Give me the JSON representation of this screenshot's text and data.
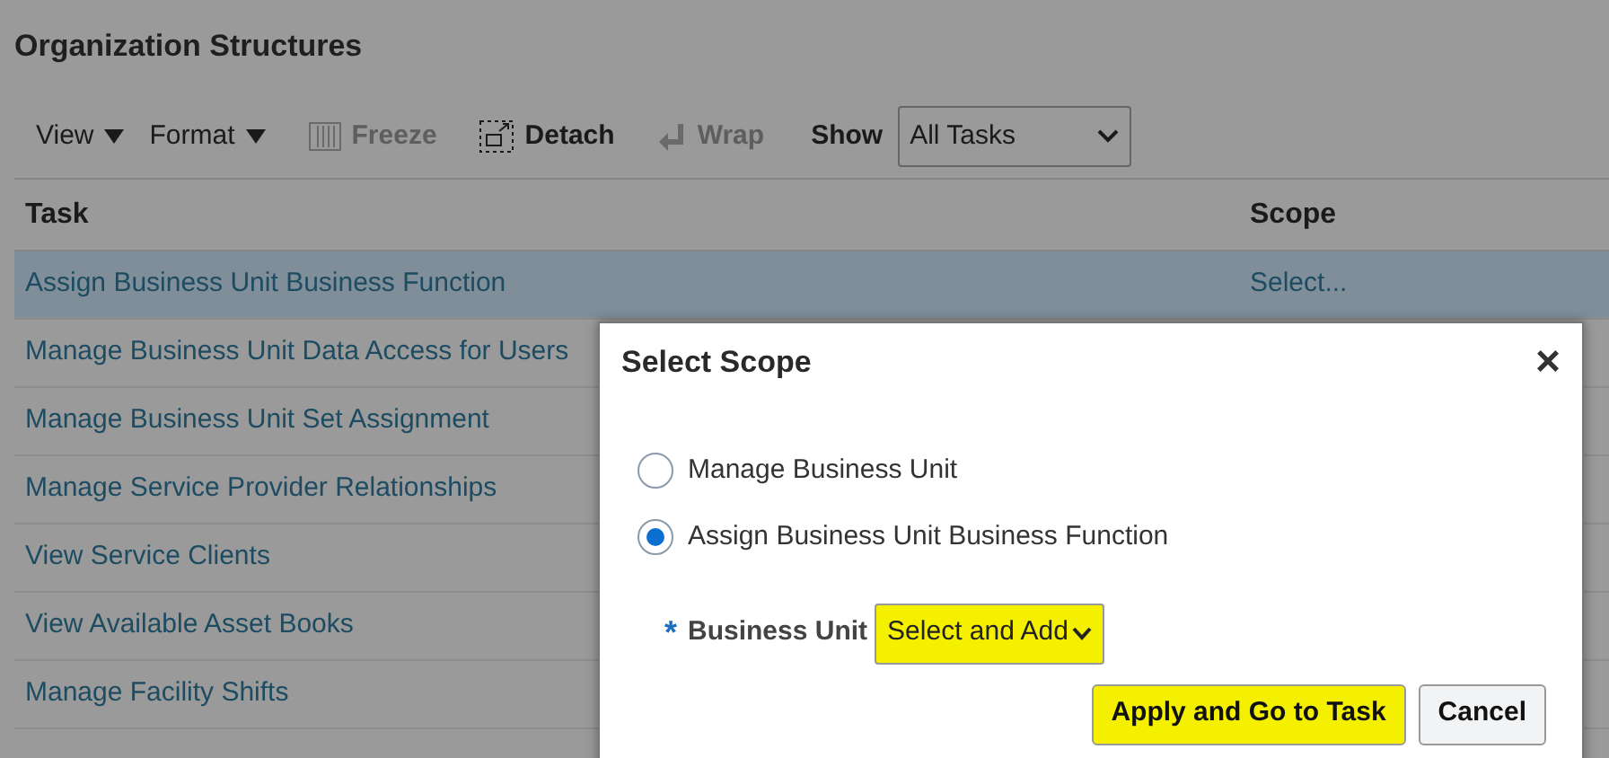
{
  "page": {
    "title": "Organization Structures"
  },
  "toolbar": {
    "items": [
      {
        "kind": "menu",
        "label": "View",
        "disabled": false
      },
      {
        "kind": "menu",
        "label": "Format",
        "disabled": false
      },
      {
        "kind": "freeze",
        "label": "Freeze",
        "disabled": true
      },
      {
        "kind": "detach",
        "label": "Detach",
        "disabled": false
      },
      {
        "kind": "wrap",
        "label": "Wrap",
        "disabled": true
      }
    ],
    "show": {
      "label": "Show",
      "value": "All Tasks"
    }
  },
  "table": {
    "columns": [
      "Task",
      "Scope"
    ],
    "rows": [
      {
        "task": "Assign Business Unit Business Function",
        "scope": "Select...",
        "selected": true
      },
      {
        "task": "Manage Business Unit Data Access for Users",
        "selected": false
      },
      {
        "task": "Manage Business Unit Set Assignment",
        "selected": false
      },
      {
        "task": "Manage Service Provider Relationships",
        "selected": false
      },
      {
        "task": "View Service Clients",
        "selected": false
      },
      {
        "task": "View Available Asset Books",
        "selected": false
      },
      {
        "task": "Manage Facility Shifts",
        "selected": false
      }
    ]
  },
  "dialog": {
    "title": "Select Scope",
    "close": "×",
    "options": [
      {
        "label": "Manage Business Unit",
        "selected": false
      },
      {
        "label": "Assign Business Unit Business Function",
        "selected": true
      }
    ],
    "field": {
      "required_mark": "*",
      "label": "Business Unit",
      "value": "Select and Add",
      "highlighted": true
    },
    "buttons": [
      {
        "label": "Apply and Go to Task",
        "highlighted": true
      },
      {
        "label": "Cancel",
        "highlighted": false
      }
    ]
  }
}
